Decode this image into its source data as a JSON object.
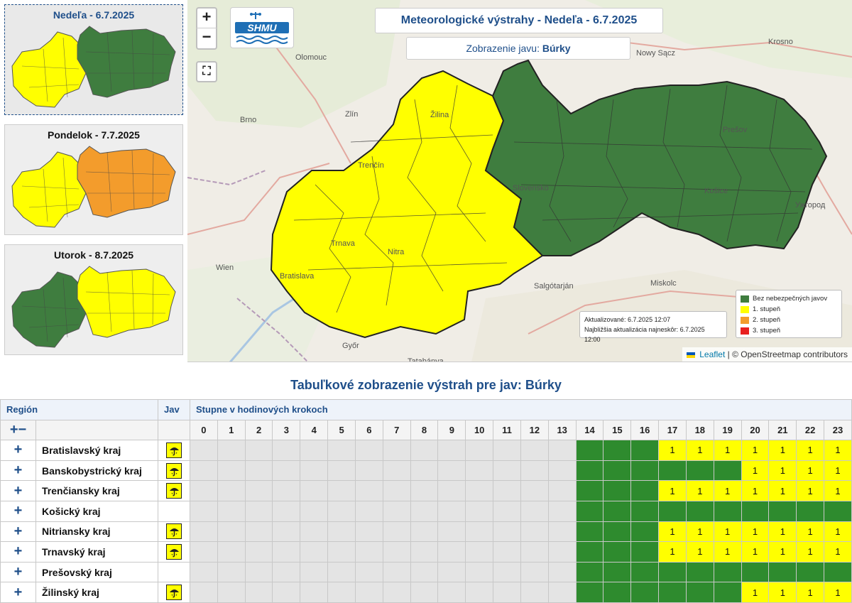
{
  "days": [
    {
      "label": "Nedeľa - 6.7.2025",
      "active": true,
      "west": "#ffff00",
      "east": "#3f7d3f"
    },
    {
      "label": "Pondelok - 7.7.2025",
      "active": false,
      "west": "#ffff00",
      "east": "#f39c2c"
    },
    {
      "label": "Utorok - 8.7.2025",
      "active": false,
      "west": "#3f7d3f",
      "east": "#ffff00"
    }
  ],
  "map": {
    "title": "Meteorologické výstrahy - Nedeľa - 6.7.2025",
    "subtitle_prefix": "Zobrazenie javu:",
    "subtitle_value": "Búrky",
    "logo_text": "SHMU",
    "zoom_in": "+",
    "zoom_out": "−",
    "fullscreen": "⛶",
    "update_line1": "Aktualizované: 6.7.2025 12:07",
    "update_line2": "Najbližšia aktualizácia najneskôr: 6.7.2025 12:00",
    "legend": [
      {
        "label": "Bez nebezpečných javov",
        "color": "#3f7d3f"
      },
      {
        "label": "1. stupeň",
        "color": "#ffff00"
      },
      {
        "label": "2. stupeň",
        "color": "#f39c2c"
      },
      {
        "label": "3. stupeň",
        "color": "#e8201f"
      }
    ],
    "attribution_link": "Leaflet",
    "attribution_rest": "| © OpenStreetmap contributors",
    "cities": [
      {
        "name": "Olomouc"
      },
      {
        "name": "Zlín"
      },
      {
        "name": "Brno"
      },
      {
        "name": "Žilina"
      },
      {
        "name": "Trenčín"
      },
      {
        "name": "Trnava"
      },
      {
        "name": "Nitra"
      },
      {
        "name": "Bratislava"
      },
      {
        "name": "Wien"
      },
      {
        "name": "Győr"
      },
      {
        "name": "Tatabánya"
      },
      {
        "name": "Salgótarján"
      },
      {
        "name": "Miskolc"
      },
      {
        "name": "Prešov"
      },
      {
        "name": "Košice"
      },
      {
        "name": "Slovensko"
      },
      {
        "name": "Nowy Sącz"
      },
      {
        "name": "Krosno"
      },
      {
        "name": "Ужгород"
      }
    ]
  },
  "table": {
    "title": "Tabuľkové zobrazenie výstrah pre jav: Búrky",
    "header_region": "Región",
    "header_jav": "Jav",
    "header_steps": "Stupne v hodinových krokoch",
    "expand_all": "+−",
    "hours": [
      "0",
      "1",
      "2",
      "3",
      "4",
      "5",
      "6",
      "7",
      "8",
      "9",
      "10",
      "11",
      "12",
      "13",
      "14",
      "15",
      "16",
      "17",
      "18",
      "19",
      "20",
      "21",
      "22",
      "23"
    ],
    "rows": [
      {
        "name": "Bratislavský kraj",
        "icon": true,
        "cells": [
          0,
          0,
          0,
          0,
          0,
          0,
          0,
          0,
          0,
          0,
          0,
          0,
          0,
          0,
          "g",
          "g",
          "g",
          1,
          1,
          1,
          1,
          1,
          1,
          1
        ]
      },
      {
        "name": "Banskobystrický kraj",
        "icon": true,
        "cells": [
          0,
          0,
          0,
          0,
          0,
          0,
          0,
          0,
          0,
          0,
          0,
          0,
          0,
          0,
          "g",
          "g",
          "g",
          "g",
          "g",
          "g",
          1,
          1,
          1,
          1
        ]
      },
      {
        "name": "Trenčiansky kraj",
        "icon": true,
        "cells": [
          0,
          0,
          0,
          0,
          0,
          0,
          0,
          0,
          0,
          0,
          0,
          0,
          0,
          0,
          "g",
          "g",
          "g",
          1,
          1,
          1,
          1,
          1,
          1,
          1
        ]
      },
      {
        "name": "Košický kraj",
        "icon": false,
        "cells": [
          0,
          0,
          0,
          0,
          0,
          0,
          0,
          0,
          0,
          0,
          0,
          0,
          0,
          0,
          "g",
          "g",
          "g",
          "g",
          "g",
          "g",
          "g",
          "g",
          "g",
          "g"
        ]
      },
      {
        "name": "Nitriansky kraj",
        "icon": true,
        "cells": [
          0,
          0,
          0,
          0,
          0,
          0,
          0,
          0,
          0,
          0,
          0,
          0,
          0,
          0,
          "g",
          "g",
          "g",
          1,
          1,
          1,
          1,
          1,
          1,
          1
        ]
      },
      {
        "name": "Trnavský kraj",
        "icon": true,
        "cells": [
          0,
          0,
          0,
          0,
          0,
          0,
          0,
          0,
          0,
          0,
          0,
          0,
          0,
          0,
          "g",
          "g",
          "g",
          1,
          1,
          1,
          1,
          1,
          1,
          1
        ]
      },
      {
        "name": "Prešovský kraj",
        "icon": false,
        "cells": [
          0,
          0,
          0,
          0,
          0,
          0,
          0,
          0,
          0,
          0,
          0,
          0,
          0,
          0,
          "g",
          "g",
          "g",
          "g",
          "g",
          "g",
          "g",
          "g",
          "g",
          "g"
        ]
      },
      {
        "name": "Žilinský kraj",
        "icon": true,
        "cells": [
          0,
          0,
          0,
          0,
          0,
          0,
          0,
          0,
          0,
          0,
          0,
          0,
          0,
          0,
          "g",
          "g",
          "g",
          "g",
          "g",
          "g",
          1,
          1,
          1,
          1
        ]
      }
    ],
    "expand_symbol": "+",
    "level_colors": {
      "0": "#e4e4e4",
      "1": "#ffff00",
      "g": "#2e8b2e"
    }
  }
}
